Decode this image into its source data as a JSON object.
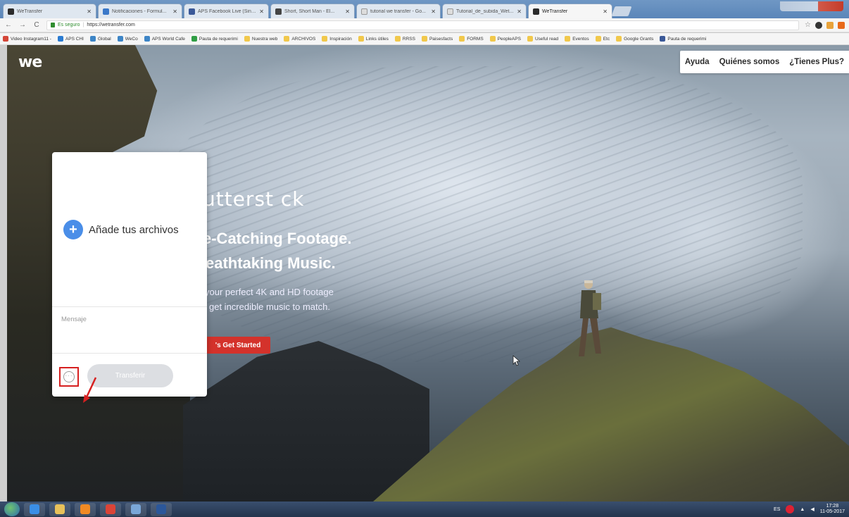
{
  "browser": {
    "tabs": [
      {
        "title": "WeTransfer",
        "active": false,
        "color": "#2b2b2b"
      },
      {
        "title": "Notificaciones - Formul...",
        "active": false,
        "color": "#3a78c9"
      },
      {
        "title": "APS Facebook Live (Sin t...",
        "active": false,
        "color": "#3b5998"
      },
      {
        "title": "Short, Short Man - El...",
        "active": false,
        "color": "#444444"
      },
      {
        "title": "tutorial we transfer - Go...",
        "active": false,
        "color": "#dddddd"
      },
      {
        "title": "Tutorial_de_subida_Wet...",
        "active": false,
        "color": "#dddddd"
      },
      {
        "title": "WeTransfer",
        "active": true,
        "color": "#2b2b2b"
      }
    ],
    "nav": {
      "back": "←",
      "forward": "→",
      "reload": "C"
    },
    "address": {
      "secure_label": "Es seguro",
      "url": "https://wetransfer.com"
    },
    "toolbar_icons": [
      "star-icon",
      "extension-icon",
      "extension-icon",
      "extension-icon"
    ],
    "bookmarks": [
      {
        "label": "Video Instagram11 -",
        "icon": "gmail-icon",
        "color": "#d44638"
      },
      {
        "label": "APS CHI",
        "icon": "site-icon",
        "color": "#2a7bd1"
      },
      {
        "label": "Global",
        "icon": "site-icon",
        "color": "#3d85c6"
      },
      {
        "label": "WeCo",
        "icon": "site-icon",
        "color": "#3d85c6"
      },
      {
        "label": "APS World Cafe",
        "icon": "site-icon",
        "color": "#3d85c6"
      },
      {
        "label": "Pauta de requerimi",
        "icon": "drive-icon",
        "color": "#2f9e44"
      },
      {
        "label": "Nuestra web",
        "icon": "folder-icon",
        "color": "#f1c84b"
      },
      {
        "label": "ARCHIVOS",
        "icon": "folder-icon",
        "color": "#f1c84b"
      },
      {
        "label": "Inspiración",
        "icon": "folder-icon",
        "color": "#f1c84b"
      },
      {
        "label": "Links útiles",
        "icon": "folder-icon",
        "color": "#f1c84b"
      },
      {
        "label": "RRSS",
        "icon": "folder-icon",
        "color": "#f1c84b"
      },
      {
        "label": "Paisesfacts",
        "icon": "folder-icon",
        "color": "#f1c84b"
      },
      {
        "label": "FORMS",
        "icon": "folder-icon",
        "color": "#f1c84b"
      },
      {
        "label": "PeopleAPS",
        "icon": "folder-icon",
        "color": "#f1c84b"
      },
      {
        "label": "Useful read",
        "icon": "folder-icon",
        "color": "#f1c84b"
      },
      {
        "label": "Eventos",
        "icon": "folder-icon",
        "color": "#f1c84b"
      },
      {
        "label": "Etc",
        "icon": "folder-icon",
        "color": "#f1c84b"
      },
      {
        "label": "Google Grants",
        "icon": "folder-icon",
        "color": "#f1c84b"
      },
      {
        "label": "Pauta de requerimi",
        "icon": "site-icon",
        "color": "#3b5998"
      }
    ]
  },
  "page": {
    "logo": "we",
    "nav": [
      "Ayuda",
      "Quiénes somos",
      "¿Tienes Plus?"
    ],
    "ad": {
      "brand": "utterst ck",
      "line1": "e-Catching Footage.",
      "line2": "eathtaking Music.",
      "sub1": "your perfect 4K and HD footage",
      "sub2": "get incredible music to match.",
      "cta": "'s Get Started"
    },
    "panel": {
      "add_files": "Añade tus archivos",
      "message_placeholder": "Mensaje",
      "transfer_button": "Transferir",
      "options_glyph": "···"
    }
  },
  "taskbar": {
    "apps": [
      {
        "name": "ie-icon",
        "color": "#3a8ee6"
      },
      {
        "name": "explorer-icon",
        "color": "#e8c15a"
      },
      {
        "name": "media-player-icon",
        "color": "#f08a24"
      },
      {
        "name": "chrome-icon",
        "color": "#db4437"
      },
      {
        "name": "app-icon",
        "color": "#7aa7d8"
      },
      {
        "name": "word-icon",
        "color": "#2b579a"
      }
    ],
    "tray": {
      "lang": "ES",
      "time": "17:28",
      "date": "11-05-2017"
    }
  },
  "colors": {
    "accent_blue": "#4a8ee8",
    "highlight_red": "#d62020",
    "cta_red": "#d4322b"
  }
}
